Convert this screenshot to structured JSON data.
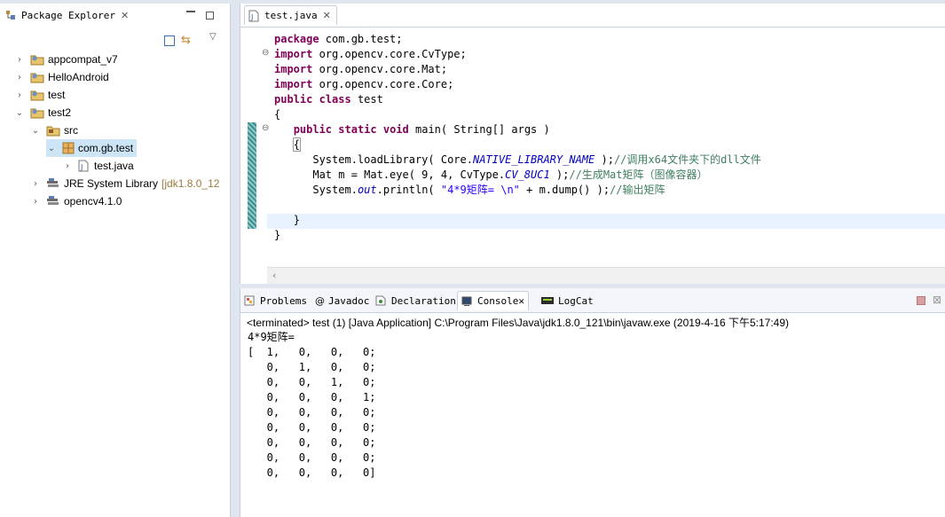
{
  "package_explorer": {
    "title": "Package Explorer",
    "items": [
      {
        "label": "appcompat_v7",
        "arrow": "›",
        "icon": "project-icon"
      },
      {
        "label": "HelloAndroid",
        "arrow": "›",
        "icon": "project-icon"
      },
      {
        "label": "test",
        "arrow": "›",
        "icon": "project-icon"
      },
      {
        "label": "test2",
        "arrow": "⌄",
        "icon": "project-open-icon"
      },
      {
        "label": "src",
        "arrow": "⌄",
        "icon": "source-folder-icon"
      },
      {
        "label": "com.gb.test",
        "arrow": "⌄",
        "icon": "package-icon"
      },
      {
        "label": "test.java",
        "arrow": "›",
        "icon": "java-file-icon"
      },
      {
        "label": "JRE System Library",
        "suffix": "[jdk1.8.0_12",
        "arrow": "›",
        "icon": "library-icon"
      },
      {
        "label": "opencv4.1.0",
        "arrow": "›",
        "icon": "library-icon"
      }
    ]
  },
  "editor": {
    "tab_title": "test.java",
    "code": {
      "l1_kw": "package",
      "l1_rest": " com.gb.test;",
      "l2_kw": "import",
      "l2_rest": " org.opencv.core.CvType;",
      "l3_kw": "import",
      "l3_rest": " org.opencv.core.Mat;",
      "l4_kw": "import",
      "l4_rest": " org.opencv.core.Core;",
      "l5_kw1": "public",
      "l5_kw2": "class",
      "l5_rest": " test",
      "l6": "{",
      "l7_kw1": "public",
      "l7_kw2": "static",
      "l7_kw3": "void",
      "l7_rest": " main( String[] args )",
      "l8": "{",
      "l9_a": "System.loadLibrary( Core.",
      "l9_static": "NATIVE_LIBRARY_NAME",
      "l9_b": " );",
      "l9_cmt": "//调用x64文件夹下的dll文件",
      "l10_a": "Mat m = Mat.eye( 9, 4, CvType.",
      "l10_static": "CV_8UC1",
      "l10_b": " );",
      "l10_cmt": "//生成Mat矩阵（图像容器）",
      "l11_a": "System.",
      "l11_static": "out",
      "l11_b": ".println( ",
      "l11_str": "\"4*9矩阵= \\n\"",
      "l11_c": " + m.dump() );",
      "l11_cmt": "//输出矩阵",
      "l13": "}",
      "l14": "}"
    }
  },
  "console": {
    "tabs": [
      "Problems",
      "Javadoc",
      "Declaration",
      "Console",
      "LogCat"
    ],
    "active_tab": "Console",
    "terminated_line": "<terminated> test (1) [Java Application] C:\\Program Files\\Java\\jdk1.8.0_121\\bin\\javaw.exe (2019-4-16 下午5:17:49)",
    "output_lines": [
      "4*9矩阵=",
      "[  1,   0,   0,   0;",
      "   0,   1,   0,   0;",
      "   0,   0,   1,   0;",
      "   0,   0,   0,   1;",
      "   0,   0,   0,   0;",
      "   0,   0,   0,   0;",
      "   0,   0,   0,   0;",
      "   0,   0,   0,   0;",
      "   0,   0,   0,   0]"
    ]
  },
  "colors": {
    "keyword": "#7f0055",
    "string": "#2a00ff",
    "comment": "#3f7f5f",
    "static_field": "#0000c0",
    "library_suffix": "#9a7b3b"
  }
}
